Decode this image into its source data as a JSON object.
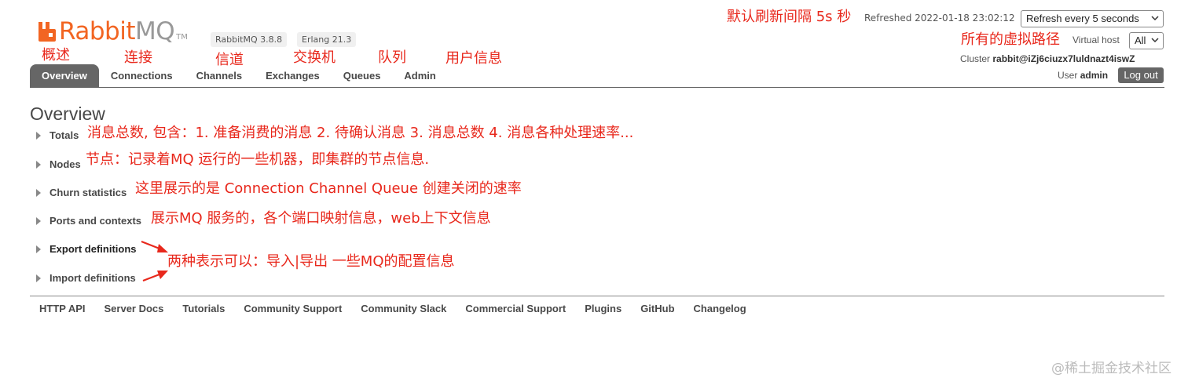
{
  "logo": {
    "brand": "Rabbit",
    "brand_suffix": "MQ",
    "tm": "TM"
  },
  "versions": {
    "rabbitmq": "RabbitMQ 3.8.8",
    "erlang": "Erlang 21.3"
  },
  "nav": {
    "tabs": [
      "Overview",
      "Connections",
      "Channels",
      "Exchanges",
      "Queues",
      "Admin"
    ],
    "active": "Overview"
  },
  "header": {
    "refreshed": "Refreshed 2022-01-18 23:02:12",
    "refresh_select": "Refresh every 5 seconds",
    "virtual_host_label": "Virtual host",
    "virtual_host_value": "All",
    "cluster_label": "Cluster",
    "cluster_value": "rabbit@iZj6ciuzx7luldnazt4iswZ",
    "user_label": "User",
    "user_value": "admin",
    "logout": "Log out"
  },
  "annotations": {
    "refresh": "默认刷新间隔 5s 秒",
    "vhost": "所有的虚拟路径",
    "tab_overview": "概述",
    "tab_connections": "连接",
    "tab_channels": "信道",
    "tab_exchanges": "交换机",
    "tab_queues": "队列",
    "tab_admin": "用户信息",
    "totals": "消息总数, 包含：1. 准备消费的消息  2. 待确认消息  3. 消息总数  4. 消息各种处理速率...",
    "nodes": "节点：记录着MQ 运行的一些机器，即集群的节点信息.",
    "churn": "这里展示的是 Connection  Channel  Queue 创建关闭的速率",
    "ports": "展示MQ 服务的，各个端口映射信息，web上下文信息",
    "definitions": "两种表示可以：导入|导出 一些MQ的配置信息"
  },
  "main": {
    "title": "Overview",
    "sections": [
      "Totals",
      "Nodes",
      "Churn statistics",
      "Ports and contexts",
      "Export definitions",
      "Import definitions"
    ]
  },
  "footer": {
    "links": [
      "HTTP API",
      "Server Docs",
      "Tutorials",
      "Community Support",
      "Community Slack",
      "Commercial Support",
      "Plugins",
      "GitHub",
      "Changelog"
    ]
  },
  "watermark": "@稀土掘金技术社区",
  "colors": {
    "brand_orange": "#f26522",
    "annotation_red": "#e8281c",
    "tab_active": "#666666"
  }
}
